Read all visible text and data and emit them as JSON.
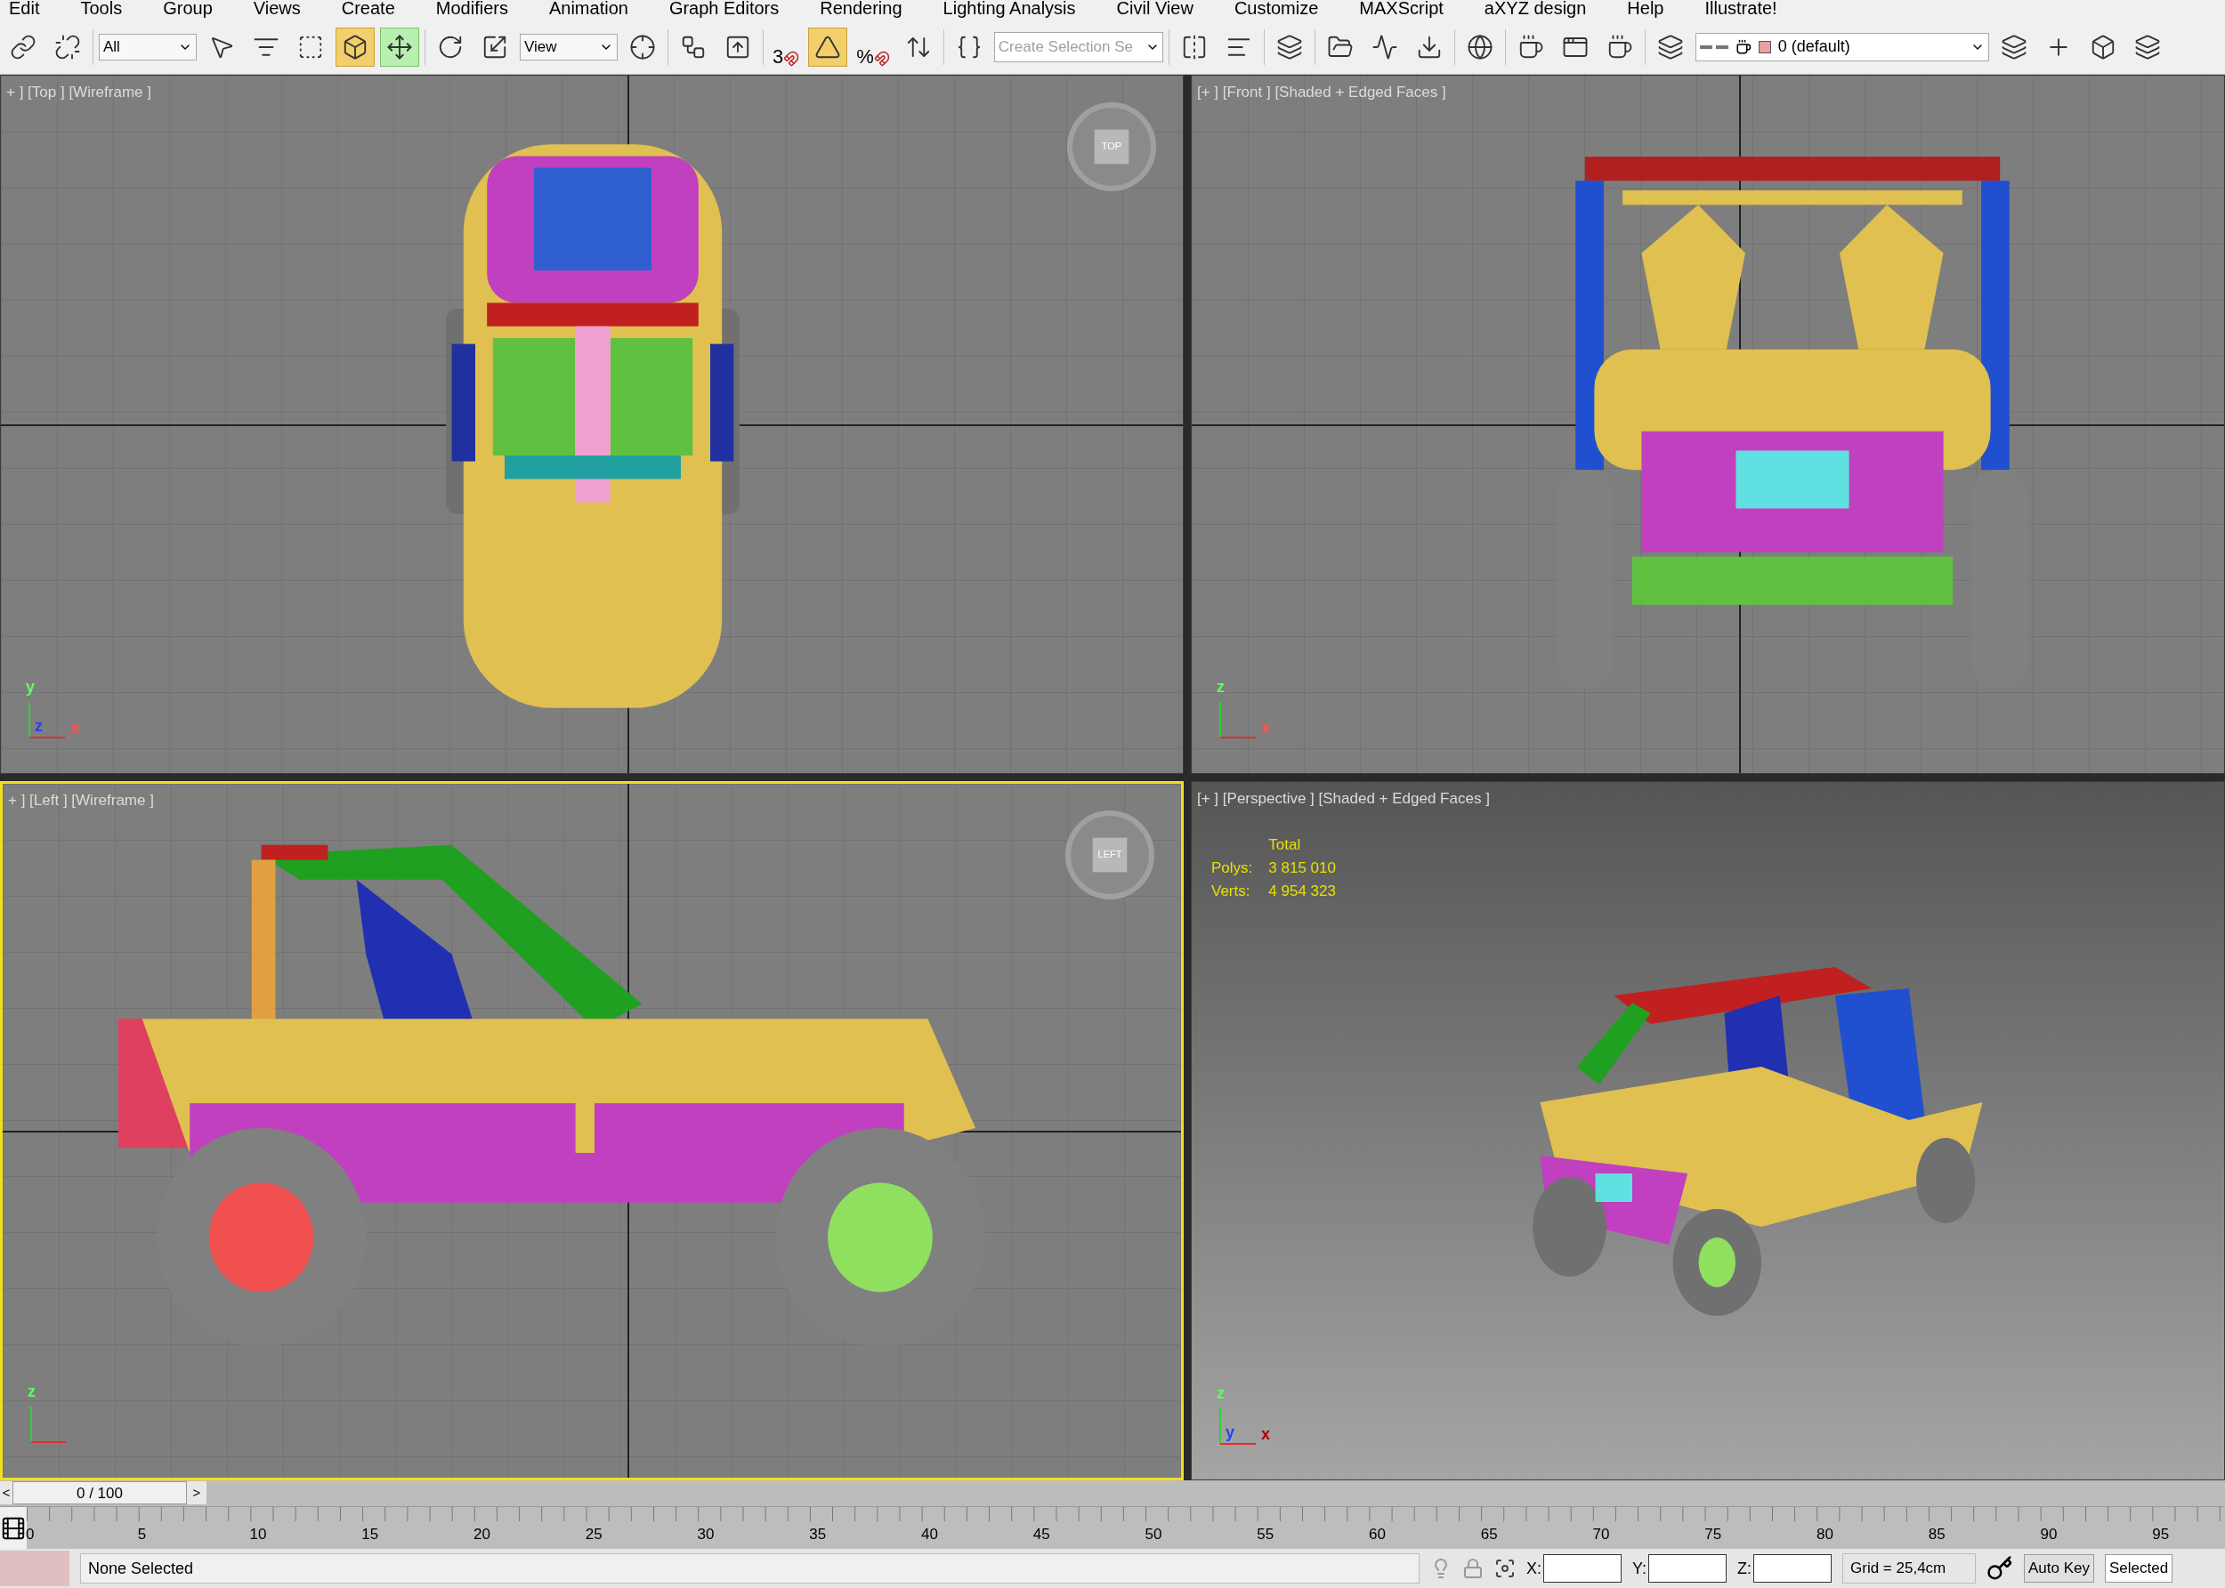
{
  "menu_bar": [
    "Edit",
    "Tools",
    "Group",
    "Views",
    "Create",
    "Modifiers",
    "Animation",
    "Graph Editors",
    "Rendering",
    "Lighting Analysis",
    "Civil View",
    "Customize",
    "MAXScript",
    "aXYZ design",
    "Help",
    "Illustrate!"
  ],
  "toolbar": [
    {
      "kind": "button",
      "selected": false
    },
    {
      "kind": "button",
      "selected": false
    },
    {
      "kind": "separator"
    },
    {
      "kind": "dropdown",
      "value": "All"
    },
    {
      "kind": "button",
      "selected": false
    },
    {
      "kind": "button",
      "selected": false
    },
    {
      "kind": "button",
      "selected": false
    },
    {
      "kind": "button",
      "selected": true
    },
    {
      "kind": "transform",
      "selected": true
    },
    {
      "kind": "separator"
    },
    {
      "kind": "button",
      "selected": false
    },
    {
      "kind": "button",
      "selected": false
    },
    {
      "kind": "dropdown",
      "value": "View"
    },
    {
      "kind": "button",
      "selected": false
    },
    {
      "kind": "separator"
    },
    {
      "kind": "button",
      "selected": false
    },
    {
      "kind": "button",
      "selected": false
    },
    {
      "kind": "separator"
    },
    {
      "kind": "snap",
      "glyph": "3",
      "selected": false
    },
    {
      "kind": "button",
      "selected": true
    },
    {
      "kind": "snap",
      "glyph": "%",
      "selected": false
    },
    {
      "kind": "button",
      "selected": false
    },
    {
      "kind": "separator"
    },
    {
      "kind": "button",
      "selected": false
    },
    {
      "kind": "field",
      "placeholder": "Create Selection Se"
    },
    {
      "kind": "separator"
    },
    {
      "kind": "button",
      "selected": false
    },
    {
      "kind": "button",
      "selected": false
    },
    {
      "kind": "separator"
    },
    {
      "kind": "button",
      "selected": false
    },
    {
      "kind": "separator"
    },
    {
      "kind": "button",
      "selected": false
    },
    {
      "kind": "button",
      "selected": false
    },
    {
      "kind": "button",
      "selected": false
    },
    {
      "kind": "separator"
    },
    {
      "kind": "button",
      "selected": false
    },
    {
      "kind": "separator"
    },
    {
      "kind": "button",
      "selected": false
    },
    {
      "kind": "button",
      "selected": false
    },
    {
      "kind": "button",
      "selected": false
    },
    {
      "kind": "separator"
    },
    {
      "kind": "button",
      "selected": false
    },
    {
      "kind": "layer",
      "value": "0 (default)",
      "color": "#e8a0a0"
    },
    {
      "kind": "button",
      "selected": false
    },
    {
      "kind": "button",
      "selected": false
    },
    {
      "kind": "button",
      "selected": false
    },
    {
      "kind": "button",
      "selected": false
    }
  ],
  "viewports": [
    {
      "label": "+ ] [Top ] [Wireframe ]",
      "kind": "top",
      "selected": false,
      "viewcube": "TOP",
      "axes": [
        "y",
        "z",
        "x"
      ]
    },
    {
      "label": "[+ ] [Front ] [Shaded + Edged Faces ]",
      "kind": "front",
      "selected": false,
      "axes": [
        "z",
        "x"
      ]
    },
    {
      "label": "+ ] [Left ] [Wireframe ]",
      "kind": "left",
      "selected": true,
      "viewcube": "LEFT",
      "axes": [
        "z"
      ]
    },
    {
      "label": "[+ ] [Perspective ] [Shaded + Edged Faces ]",
      "kind": "perspective",
      "selected": false,
      "axes": [
        "z",
        "y",
        "x"
      ],
      "stats": {
        "heading": "Total",
        "rows": [
          {
            "label": "Polys:",
            "value": "3 815 010"
          },
          {
            "label": "Verts:",
            "value": "4 954 323"
          }
        ]
      }
    }
  ],
  "time_slider": {
    "prev": "<",
    "value": "0 / 100",
    "next": ">"
  },
  "track_bar": {
    "ticks": [
      "0",
      "5",
      "10",
      "15",
      "20",
      "25",
      "30",
      "35",
      "40",
      "45",
      "50",
      "55",
      "60",
      "65",
      "70",
      "75",
      "80",
      "85",
      "90",
      "95"
    ]
  },
  "status_bar": {
    "prompt": "None Selected",
    "coords": [
      "X:",
      "Y:",
      "Z:"
    ],
    "grid": "Grid = 25,4cm",
    "auto_key": "Auto Key",
    "key_mode": "Selected"
  }
}
